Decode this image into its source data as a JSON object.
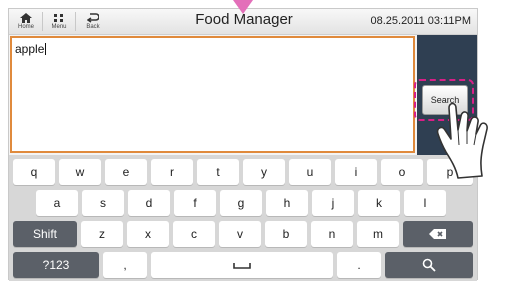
{
  "topbar": {
    "home_label": "Home",
    "menu_label": "Menu",
    "back_label": "Back",
    "title": "Food Manager",
    "datetime": "08.25.2011 03:11PM"
  },
  "search": {
    "value": "apple",
    "button_label": "Search"
  },
  "keyboard": {
    "row1": [
      "q",
      "w",
      "e",
      "r",
      "t",
      "y",
      "u",
      "i",
      "o",
      "p"
    ],
    "row2": [
      "a",
      "s",
      "d",
      "f",
      "g",
      "h",
      "j",
      "k",
      "l"
    ],
    "row3": [
      "Shift",
      "z",
      "x",
      "c",
      "v",
      "b",
      "n",
      "m"
    ],
    "row4": [
      "?123",
      ",",
      "_",
      ".",
      "search-icon"
    ],
    "backspace_icon": "backspace-icon"
  },
  "colors": {
    "pointer": "#e36fb9",
    "highlight": "#d81f87",
    "input_border": "#e08a3c",
    "panel": "#2f3f52"
  }
}
